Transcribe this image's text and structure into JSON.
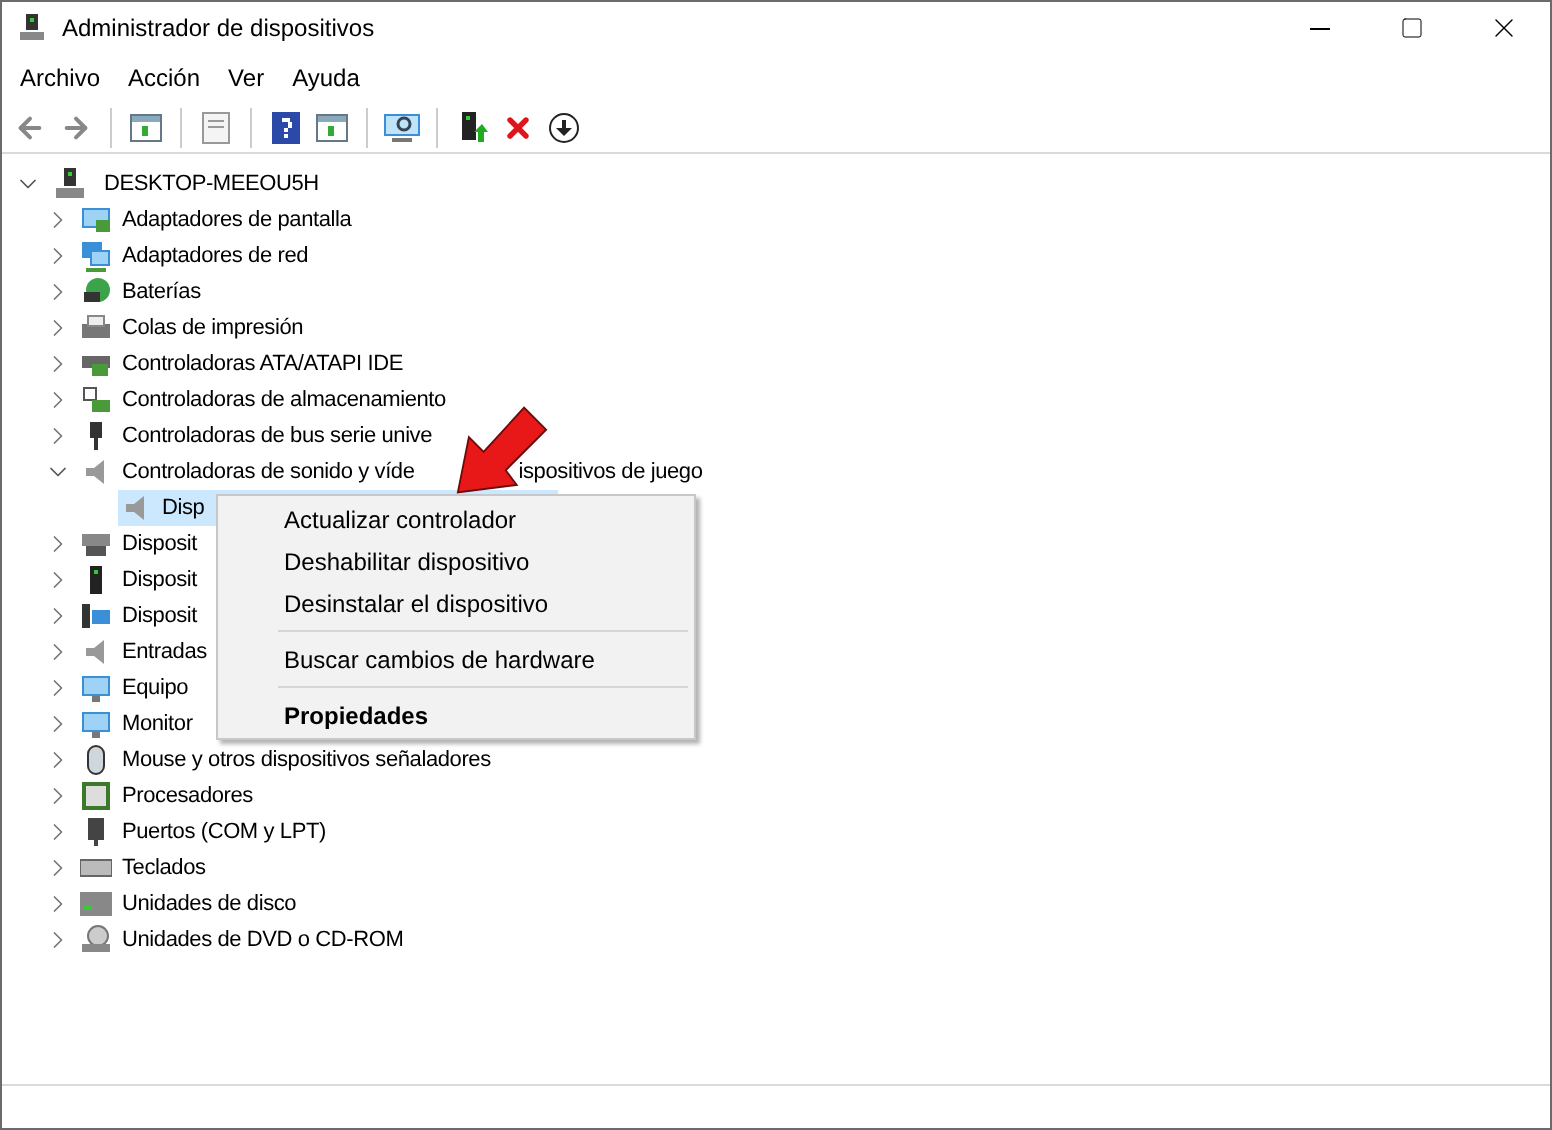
{
  "window": {
    "title": "Administrador de dispositivos"
  },
  "menu_bar": [
    "Archivo",
    "Acción",
    "Ver",
    "Ayuda"
  ],
  "tree": {
    "label": "DESKTOP-MEEOU5H",
    "expanded": true,
    "children": [
      {
        "label": "Adaptadores de pantalla",
        "expanded": false
      },
      {
        "label": "Adaptadores de red",
        "expanded": false
      },
      {
        "label": "Baterías",
        "expanded": false
      },
      {
        "label": "Colas de impresión",
        "expanded": false
      },
      {
        "label": "Controladoras ATA/ATAPI IDE",
        "expanded": false
      },
      {
        "label": "Controladoras de almacenamiento",
        "expanded": false
      },
      {
        "label": "Controladoras de bus serie unive",
        "expanded": false
      },
      {
        "label": "Controladoras de sonido y víde",
        "label_after_arrow": "ispositivos de juego",
        "expanded": true,
        "children": [
          {
            "label": "Disp",
            "selected": true
          }
        ]
      },
      {
        "label": "Disposit",
        "expanded": false
      },
      {
        "label": "Disposit",
        "expanded": false
      },
      {
        "label": "Disposit",
        "expanded": false
      },
      {
        "label": "Entradas",
        "expanded": false
      },
      {
        "label": "Equipo",
        "expanded": false
      },
      {
        "label": "Monitor",
        "expanded": false
      },
      {
        "label": "Mouse y otros dispositivos señaladores",
        "expanded": false
      },
      {
        "label": "Procesadores",
        "expanded": false
      },
      {
        "label": "Puertos (COM y LPT)",
        "expanded": false
      },
      {
        "label": "Teclados",
        "expanded": false
      },
      {
        "label": "Unidades de disco",
        "expanded": false
      },
      {
        "label": "Unidades de DVD o CD-ROM",
        "expanded": false
      }
    ]
  },
  "context_menu": {
    "items": [
      {
        "kind": "item",
        "label": "Actualizar controlador",
        "default": false
      },
      {
        "kind": "item",
        "label": "Deshabilitar dispositivo",
        "default": false
      },
      {
        "kind": "item",
        "label": "Desinstalar el dispositivo",
        "default": false
      },
      {
        "kind": "separator"
      },
      {
        "kind": "item",
        "label": "Buscar cambios de hardware",
        "default": false
      },
      {
        "kind": "separator"
      },
      {
        "kind": "item",
        "label": "Propiedades",
        "default": true
      }
    ]
  }
}
